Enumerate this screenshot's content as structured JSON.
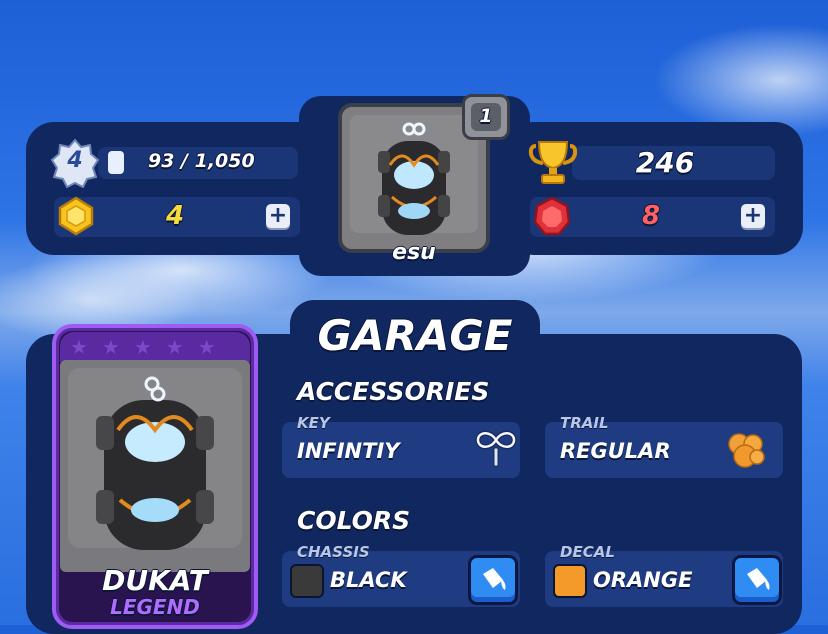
{
  "header": {
    "level": "4",
    "xp_text": "93 / 1,050",
    "xp_progress": 0.089,
    "coins": "4",
    "trophies": "246",
    "gems": "8",
    "plus_label": "+",
    "profile_name": "esu",
    "profile_badge": "1"
  },
  "garage": {
    "title": "GARAGE",
    "card": {
      "name": "DUKAT",
      "rarity": "LEGEND",
      "rarity_color": "#b06cff"
    },
    "accessories": {
      "heading": "ACCESSORIES",
      "key_label": "KEY",
      "key_value": "INFINTIY",
      "key_icon": "infinity-key-icon",
      "trail_label": "TRAIL",
      "trail_value": "REGULAR",
      "trail_icon": "smoke-puff-icon"
    },
    "colors": {
      "heading": "COLORS",
      "chassis_label": "CHASSIS",
      "chassis_value": "BLACK",
      "chassis_color": "#3a3a3a",
      "decal_label": "DECAL",
      "decal_value": "ORANGE",
      "decal_color": "#f39a2a",
      "paint_icon": "paint-bucket-icon"
    }
  }
}
